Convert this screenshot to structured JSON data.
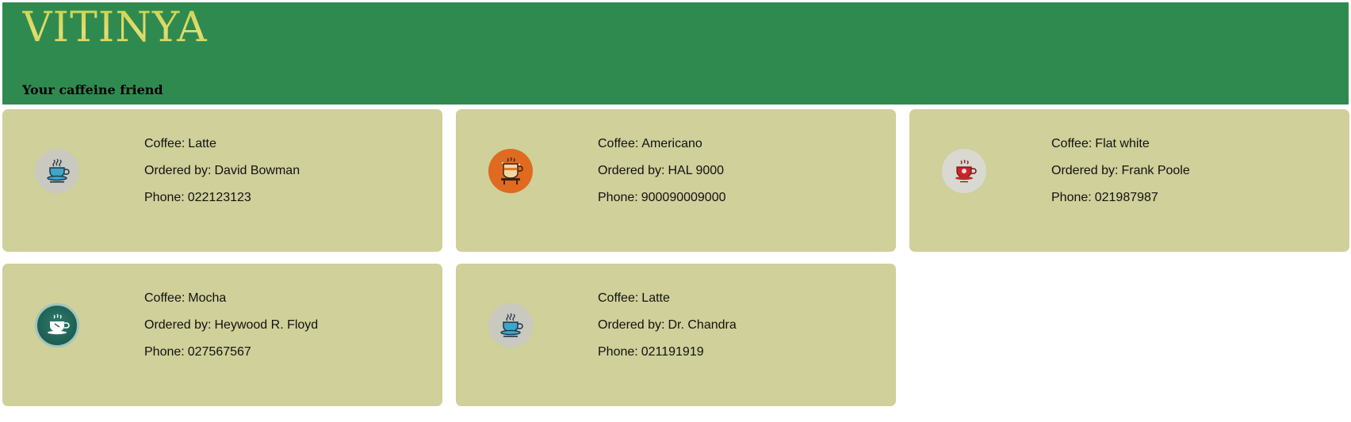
{
  "header": {
    "brand": "VITINYA",
    "tagline": "Your caffeine friend"
  },
  "labels": {
    "coffee": "Coffee:",
    "ordered_by": "Ordered by:",
    "phone": "Phone:"
  },
  "orders": [
    {
      "coffee": "Latte",
      "ordered_by": "David Bowman",
      "phone": "022123123",
      "icon": "coffee-cup-saucer-icon"
    },
    {
      "coffee": "Americano",
      "ordered_by": "HAL 9000",
      "phone": "900090009000",
      "icon": "coffee-cup-stand-icon"
    },
    {
      "coffee": "Flat white",
      "ordered_by": "Frank Poole",
      "phone": "021987987",
      "icon": "red-coffee-cup-icon"
    },
    {
      "coffee": "Mocha",
      "ordered_by": "Heywood R. Floyd",
      "phone": "027567567",
      "icon": "coffee-cup-badge-icon"
    },
    {
      "coffee": "Latte",
      "ordered_by": "Dr. Chandra",
      "phone": "021191919",
      "icon": "coffee-cup-saucer-icon"
    }
  ],
  "colors": {
    "header_bg": "#2f8a50",
    "brand_text": "#d4d65a",
    "card_bg": "#cfd09a",
    "page_bg": "#ffffff"
  }
}
